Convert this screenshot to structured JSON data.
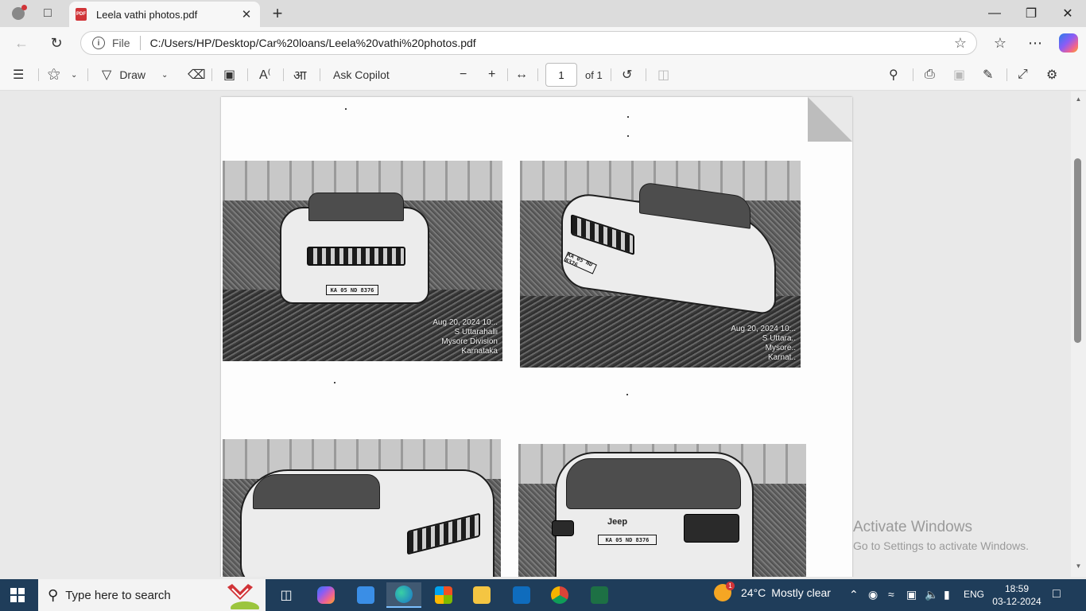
{
  "browser": {
    "tab": {
      "title": "Leela vathi photos.pdf",
      "favicon": "PDF"
    },
    "address": {
      "scheme_label": "File",
      "url": "C:/Users/HP/Desktop/Car%20loans/Leela%20vathi%20photos.pdf"
    }
  },
  "pdf_toolbar": {
    "draw_label": "Draw",
    "ask_copilot_label": "Ask Copilot",
    "page_number": "1",
    "page_total": "of 1"
  },
  "document": {
    "photos": [
      {
        "plate": "KA 05 ND 8376",
        "stamp": [
          "Aug 20, 2024 10:..",
          "S Uttarahalli",
          "Mysore Division",
          "Karnataka"
        ]
      },
      {
        "plate": "KA 05 ND 8376",
        "stamp": [
          "Aug 20, 2024 10:..",
          "S Uttara..",
          "Mysore..",
          "Karnat.."
        ]
      },
      {
        "plate": "",
        "stamp": []
      },
      {
        "plate": "KA 05 ND 8376",
        "brand": "Jeep",
        "stamp": []
      }
    ]
  },
  "watermark": {
    "title": "Activate Windows",
    "subtitle": "Go to Settings to activate Windows."
  },
  "taskbar": {
    "search_placeholder": "Type here to search",
    "weather": {
      "temp": "24°C",
      "condition": "Mostly clear",
      "alert_count": "1"
    },
    "language": "ENG",
    "time": "18:59",
    "date": "03-12-2024"
  },
  "colors": {
    "pdf_red": "#d13438",
    "taskbar_bg": "#1f3d5a",
    "toolbar_bg": "#f7f7f7",
    "viewer_bg": "#e9e9e9"
  }
}
